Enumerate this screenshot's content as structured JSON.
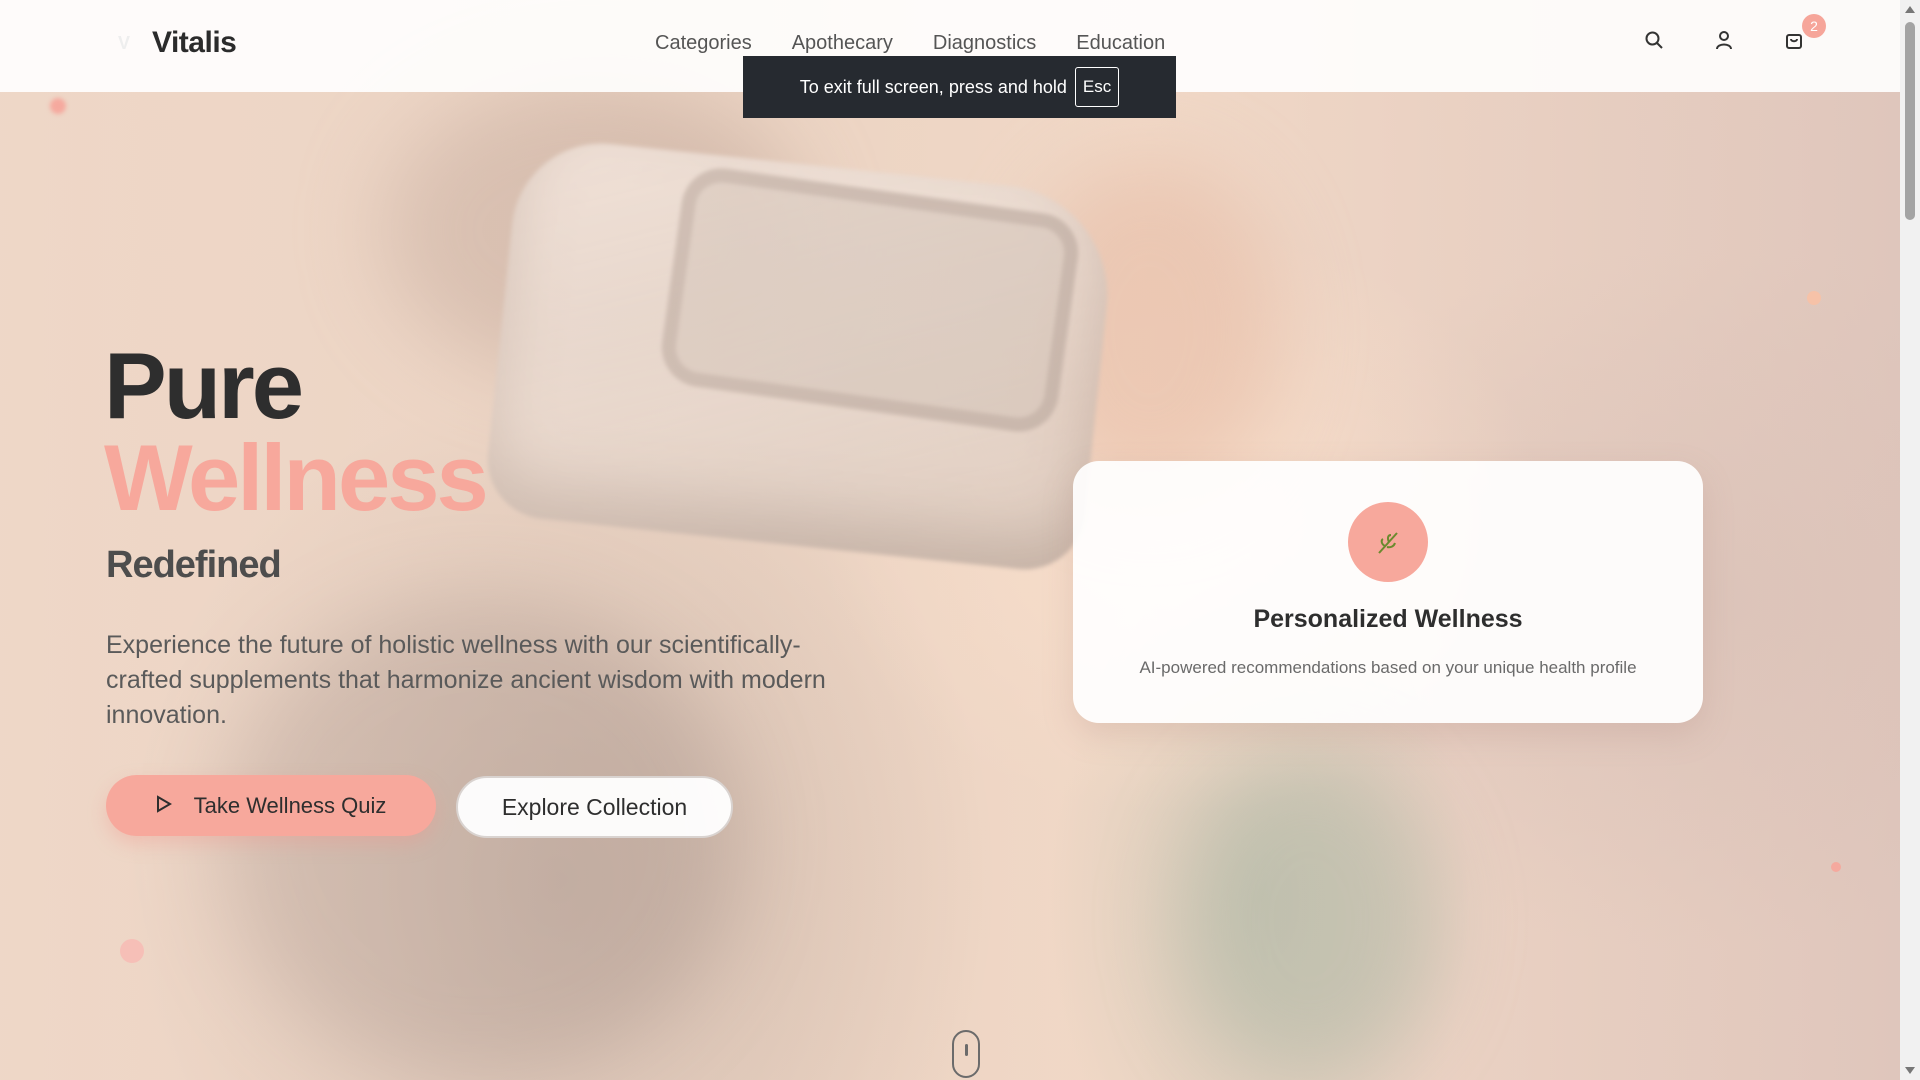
{
  "brand": {
    "name": "Vitalis",
    "logo_icon": "leaf-v-icon"
  },
  "nav": {
    "items": [
      {
        "label": "Categories"
      },
      {
        "label": "Apothecary"
      },
      {
        "label": "Diagnostics"
      },
      {
        "label": "Education"
      }
    ]
  },
  "header_icons": {
    "search": "search-icon",
    "account": "user-icon",
    "cart": "shopping-bag-icon",
    "cart_count": "2"
  },
  "fullscreen_toast": {
    "text": "To exit full screen, press and hold",
    "key": "Esc"
  },
  "hero": {
    "title_line1": "Pure",
    "title_line2": "Wellness",
    "title_line3": "Redefined",
    "description": "Experience the future of holistic wellness with our scientifically-crafted supplements that harmonize ancient wisdom with modern innovation.",
    "primary_button": "Take Wellness Quiz",
    "primary_icon": "play-icon",
    "secondary_button": "Explore Collection"
  },
  "feature_card": {
    "icon": "herb-icon",
    "title": "Personalized Wellness",
    "text": "AI-powered recommendations based on your unique health profile"
  },
  "colors": {
    "accent": "#f7a89c",
    "text_dark": "#2e2e2e",
    "toast_bg": "#262a30"
  }
}
